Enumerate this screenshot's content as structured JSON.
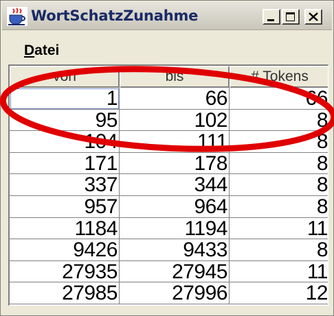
{
  "window": {
    "title": "WortSchatzZunahme",
    "icon": "coffee-cup-app-icon"
  },
  "menubar": {
    "items": [
      {
        "label": "Datei",
        "mnemonic": "D",
        "rest": "atei"
      }
    ]
  },
  "table": {
    "columns": [
      "von",
      "bis",
      "# Tokens"
    ],
    "rows": [
      [
        "1",
        "66",
        "66"
      ],
      [
        "95",
        "102",
        "8"
      ],
      [
        "104",
        "111",
        "8"
      ],
      [
        "171",
        "178",
        "8"
      ],
      [
        "337",
        "344",
        "8"
      ],
      [
        "957",
        "964",
        "8"
      ],
      [
        "1184",
        "1194",
        "11"
      ],
      [
        "9426",
        "9433",
        "8"
      ],
      [
        "27935",
        "27945",
        "11"
      ],
      [
        "27985",
        "27996",
        "12"
      ]
    ]
  },
  "colors": {
    "highlight_ellipse": "#e00000",
    "window_background": "#ece9d8",
    "title_text": "#1a2a66"
  }
}
